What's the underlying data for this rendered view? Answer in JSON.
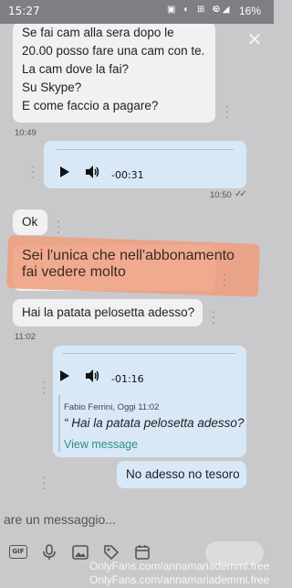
{
  "statusbar": {
    "time": "15:27",
    "notifications": "▣ ◐ ⊞ ⊙",
    "signal": "⚟ ◢",
    "battery": "16%"
  },
  "messages": [
    {
      "kind": "incoming-text",
      "lines": [
        "Se fai cam alla sera dopo le",
        "20.00 posso fare una cam con te.",
        "La cam dove la fai?",
        "Su Skype?",
        "E come faccio a pagare?"
      ],
      "time": "10:49"
    },
    {
      "kind": "outgoing-voice",
      "duration": "-00:31",
      "time": "10:50"
    },
    {
      "kind": "incoming-text",
      "lines": [
        "Ok"
      ]
    },
    {
      "kind": "incoming-text-highlighted",
      "lines": [
        "Sei l'unica che nell'abbonamento",
        "fai vedere molto"
      ]
    },
    {
      "kind": "incoming-text",
      "lines": [
        "Hai la patata pelosetta adesso?"
      ],
      "time": "11:02"
    },
    {
      "kind": "outgoing-voice",
      "duration": "-01:16"
    },
    {
      "kind": "reply-quote",
      "author": "Fabio Ferrini, Oggi 11:02",
      "quote": "“ Hai la patata pelosetta adesso?",
      "link": "View message"
    },
    {
      "kind": "outgoing-text",
      "lines": [
        "No adesso no tesoro"
      ]
    }
  ],
  "composer": {
    "placeholder": "are un messaggio..."
  },
  "toolbar": {
    "gif_label": "GIF",
    "icons": [
      "gif-icon",
      "microphone-icon",
      "image-icon",
      "tag-icon",
      "calendar-icon"
    ]
  },
  "watermark": {
    "line1": "OnlyFans.com/annamariademmi.free",
    "line2": "OnlyFans.com/annamariademmi.free"
  },
  "colors": {
    "background": "#c9c9cc",
    "incoming_bubble": "#f1f1f3",
    "outgoing_bubble": "#d8e8f7",
    "highlight": "#ef9e7c",
    "link": "#2f8f8a"
  }
}
